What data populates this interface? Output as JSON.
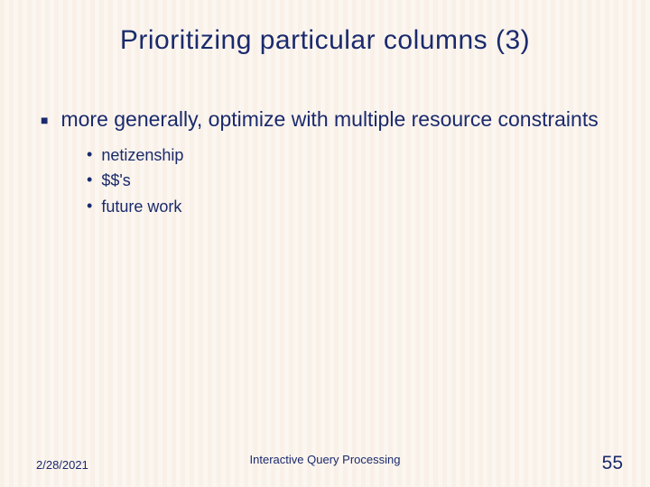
{
  "title": "Prioritizing particular columns (3)",
  "bullets": [
    {
      "text": "more generally, optimize with multiple resource constraints",
      "sub": [
        "netizenship",
        "$$'s",
        "future work"
      ]
    }
  ],
  "footer": {
    "date": "2/28/2021",
    "center": "Interactive Query Processing",
    "page": "55"
  }
}
